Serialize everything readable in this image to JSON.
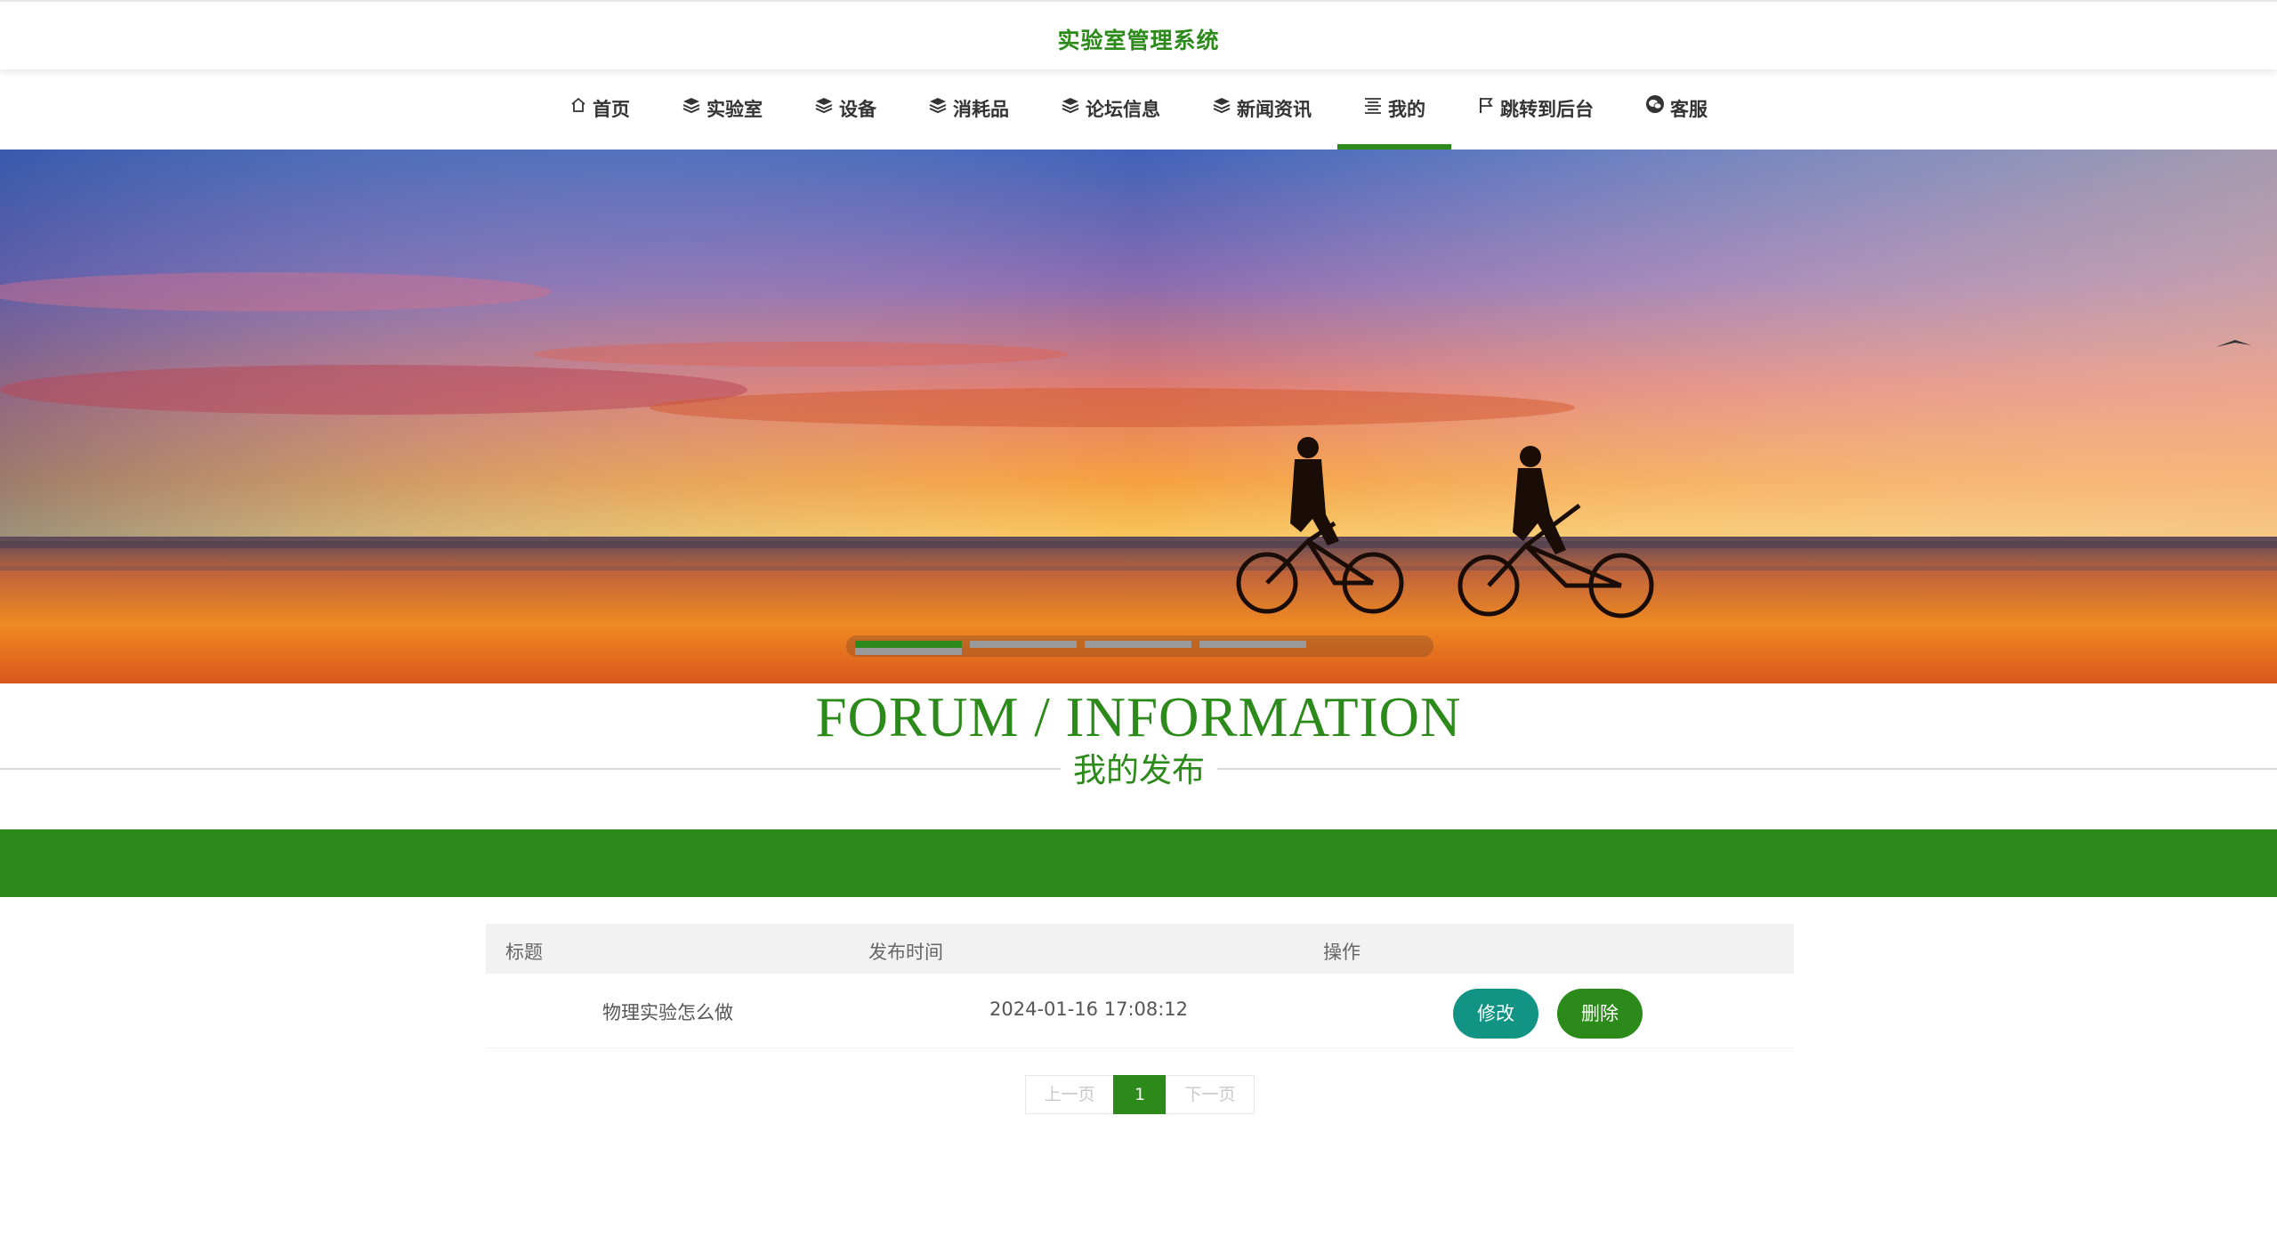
{
  "app": {
    "title": "实验室管理系统"
  },
  "nav": {
    "items": [
      {
        "label": "首页",
        "icon": "home-icon"
      },
      {
        "label": "实验室",
        "icon": "layers-icon"
      },
      {
        "label": "设备",
        "icon": "layers-icon"
      },
      {
        "label": "消耗品",
        "icon": "layers-icon"
      },
      {
        "label": "论坛信息",
        "icon": "layers-icon"
      },
      {
        "label": "新闻资讯",
        "icon": "layers-icon"
      },
      {
        "label": "我的",
        "icon": "list-icon",
        "active": true
      },
      {
        "label": "跳转到后台",
        "icon": "flag-icon"
      },
      {
        "label": "客服",
        "icon": "wechat-icon"
      }
    ]
  },
  "banner": {
    "slides": 5,
    "active_slide": 1
  },
  "section": {
    "title_en": "FORUM / INFORMATION",
    "title_cn": "我的发布"
  },
  "table": {
    "headers": [
      "标题",
      "发布时间",
      "操作"
    ],
    "rows": [
      {
        "title": "物理实验怎么做",
        "time": "2024-01-16 17:08:12",
        "edit_label": "修改",
        "delete_label": "删除"
      }
    ]
  },
  "pagination": {
    "prev": "上一页",
    "current": "1",
    "next": "下一页"
  },
  "colors": {
    "accent": "#2b8a1a",
    "edit_button": "#129484"
  }
}
